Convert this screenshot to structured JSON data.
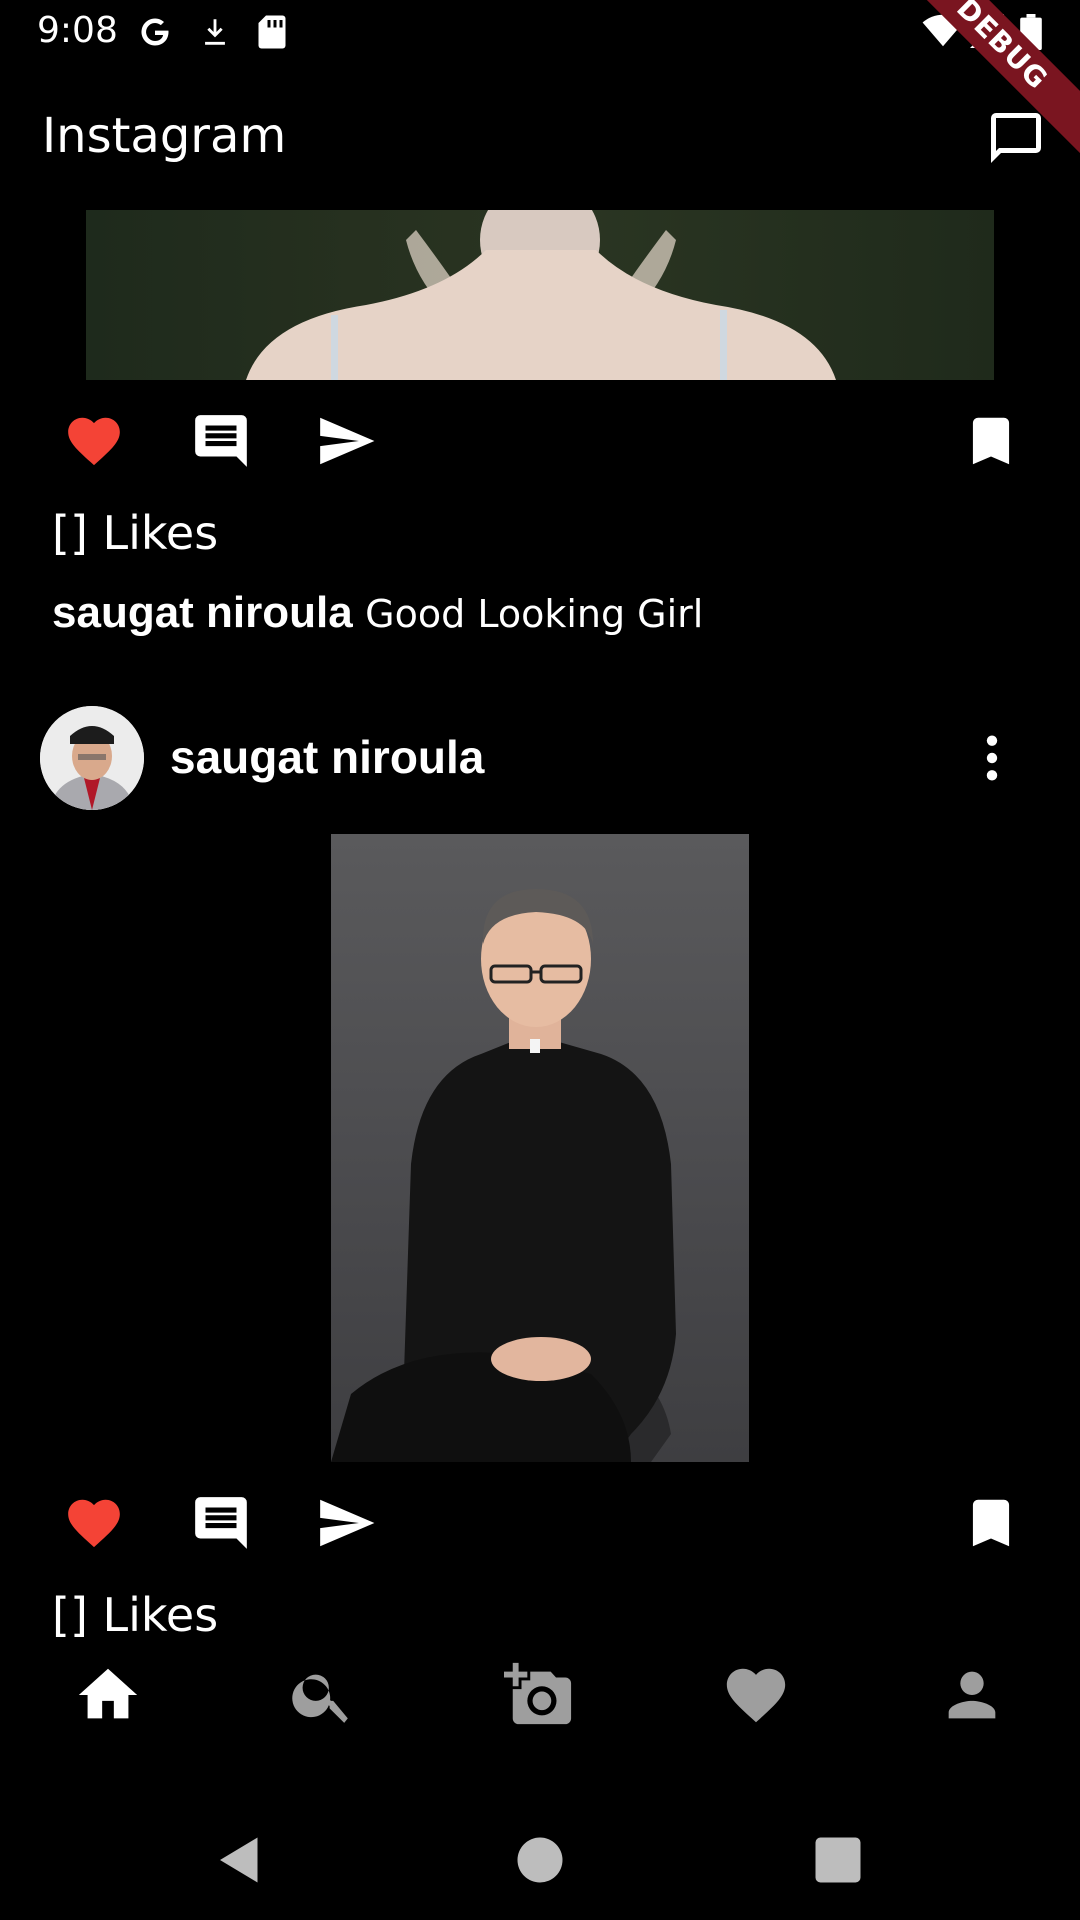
{
  "status_bar": {
    "time": "9:08",
    "icons": [
      "google-icon",
      "download-icon",
      "sd-card-icon",
      "wifi-icon",
      "cellular-icon",
      "battery-icon"
    ],
    "debug_banner": "DEBUG"
  },
  "app_bar": {
    "title": "Instagram",
    "messages_icon": "chat-bubble-icon"
  },
  "colors": {
    "background": "#000000",
    "like_red": "#f44336",
    "inactive_nav": "#9e9e9e",
    "debug_ribbon": "#7a1520"
  },
  "posts": [
    {
      "likes_label": "[] Likes",
      "caption_user": "saugat niroula",
      "caption_text": "Good Looking Girl",
      "liked": true
    },
    {
      "username": "saugat niroula",
      "likes_label": "[] Likes",
      "liked": true
    }
  ],
  "bottom_nav": {
    "items": [
      "home-icon",
      "search-icon",
      "add-photo-icon",
      "heart-icon",
      "profile-icon"
    ],
    "active": "home-icon"
  },
  "system_nav": [
    "back-icon",
    "home-circle-icon",
    "recents-icon"
  ]
}
